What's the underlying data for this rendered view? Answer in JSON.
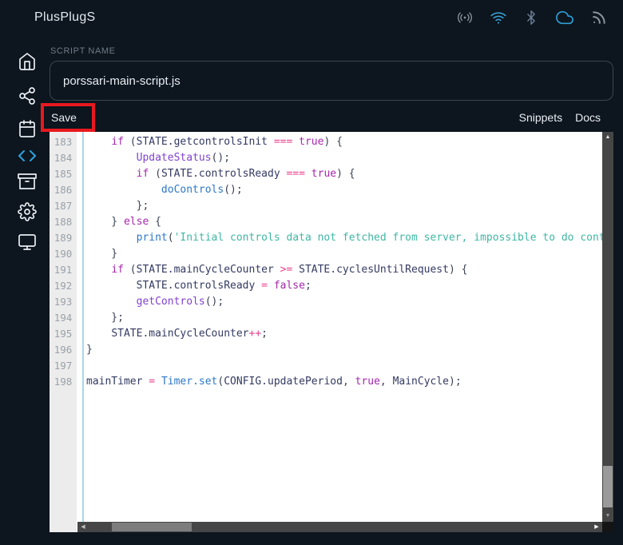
{
  "header": {
    "title": "PlusPlugS",
    "status_icons": [
      "radio",
      "wifi",
      "bluetooth",
      "cloud",
      "rss"
    ]
  },
  "sidebar": {
    "items": [
      "home",
      "integrations",
      "calendar",
      "code",
      "archive",
      "settings",
      "display"
    ],
    "active_item": "code",
    "active_color": "#2ba3dd"
  },
  "script_form": {
    "label": "SCRIPT NAME",
    "value": "porssari-main-script.js",
    "save_label": "Save",
    "snippets_label": "Snippets",
    "docs_label": "Docs"
  },
  "annotation": {
    "type": "highlight-box",
    "color": "#e8191f",
    "target": "save-button"
  },
  "editor": {
    "language": "javascript",
    "first_line_number": 183,
    "last_line_number": 198,
    "token_colors": {
      "plain": "#3b4252",
      "identifier": "#333a63",
      "keyword": "#a428ac",
      "operator": "#e83e8c",
      "function_blue": "#2d78c8",
      "function_purple": "#8042cc",
      "string": "#3fb7a3"
    },
    "lines": [
      {
        "num": "183",
        "tokens": [
          [
            "    ",
            "pl"
          ],
          [
            "if",
            "kw"
          ],
          [
            " (",
            "pl"
          ],
          [
            "STATE.getcontrolsInit",
            "id"
          ],
          [
            " ",
            "pl"
          ],
          [
            "===",
            "op"
          ],
          [
            " ",
            "pl"
          ],
          [
            "true",
            "kw"
          ],
          [
            ") {",
            "pl"
          ]
        ]
      },
      {
        "num": "184",
        "tokens": [
          [
            "        ",
            "pl"
          ],
          [
            "UpdateStatus",
            "fnp"
          ],
          [
            "();",
            "pl"
          ]
        ]
      },
      {
        "num": "185",
        "tokens": [
          [
            "        ",
            "pl"
          ],
          [
            "if",
            "kw"
          ],
          [
            " (",
            "pl"
          ],
          [
            "STATE.controlsReady",
            "id"
          ],
          [
            " ",
            "pl"
          ],
          [
            "===",
            "op"
          ],
          [
            " ",
            "pl"
          ],
          [
            "true",
            "kw"
          ],
          [
            ") {",
            "pl"
          ]
        ]
      },
      {
        "num": "186",
        "tokens": [
          [
            "            ",
            "pl"
          ],
          [
            "doControls",
            "fn"
          ],
          [
            "();",
            "pl"
          ]
        ]
      },
      {
        "num": "187",
        "tokens": [
          [
            "        };",
            "pl"
          ]
        ]
      },
      {
        "num": "188",
        "tokens": [
          [
            "    } ",
            "pl"
          ],
          [
            "else",
            "kw"
          ],
          [
            " {",
            "pl"
          ]
        ]
      },
      {
        "num": "189",
        "tokens": [
          [
            "        ",
            "pl"
          ],
          [
            "print",
            "fn"
          ],
          [
            "(",
            "pl"
          ],
          [
            "'Initial controls data not fetched from server, impossible to do cont",
            "str"
          ]
        ]
      },
      {
        "num": "190",
        "tokens": [
          [
            "    }",
            "pl"
          ]
        ]
      },
      {
        "num": "191",
        "tokens": [
          [
            "    ",
            "pl"
          ],
          [
            "if",
            "kw"
          ],
          [
            " (",
            "pl"
          ],
          [
            "STATE.mainCycleCounter",
            "id"
          ],
          [
            " ",
            "pl"
          ],
          [
            ">=",
            "op"
          ],
          [
            " ",
            "pl"
          ],
          [
            "STATE.cyclesUntilRequest",
            "id"
          ],
          [
            ") {",
            "pl"
          ]
        ]
      },
      {
        "num": "192",
        "tokens": [
          [
            "        ",
            "pl"
          ],
          [
            "STATE.controlsReady",
            "id"
          ],
          [
            " ",
            "pl"
          ],
          [
            "=",
            "op"
          ],
          [
            " ",
            "pl"
          ],
          [
            "false",
            "kw"
          ],
          [
            ";",
            "pl"
          ]
        ]
      },
      {
        "num": "193",
        "tokens": [
          [
            "        ",
            "pl"
          ],
          [
            "getControls",
            "fnp"
          ],
          [
            "();",
            "pl"
          ]
        ]
      },
      {
        "num": "194",
        "tokens": [
          [
            "    };",
            "pl"
          ]
        ]
      },
      {
        "num": "195",
        "tokens": [
          [
            "    ",
            "pl"
          ],
          [
            "STATE.mainCycleCounter",
            "id"
          ],
          [
            "++",
            "op"
          ],
          [
            ";",
            "pl"
          ]
        ]
      },
      {
        "num": "196",
        "tokens": [
          [
            "}",
            "pl"
          ]
        ]
      },
      {
        "num": "197",
        "tokens": []
      },
      {
        "num": "198",
        "tokens": [
          [
            "mainTimer",
            "id"
          ],
          [
            " ",
            "pl"
          ],
          [
            "=",
            "op"
          ],
          [
            " ",
            "pl"
          ],
          [
            "Timer.set",
            "fn"
          ],
          [
            "(",
            "pl"
          ],
          [
            "CONFIG.updatePeriod",
            "id"
          ],
          [
            ",",
            "pl"
          ],
          [
            " ",
            "pl"
          ],
          [
            "true",
            "kw"
          ],
          [
            ",",
            "pl"
          ],
          [
            " ",
            "pl"
          ],
          [
            "MainCycle",
            "id"
          ],
          [
            ");",
            "pl"
          ]
        ]
      }
    ],
    "scrollbar_glyphs": {
      "up": "▲",
      "down": "▼",
      "left": "◀",
      "right": "▶"
    }
  }
}
